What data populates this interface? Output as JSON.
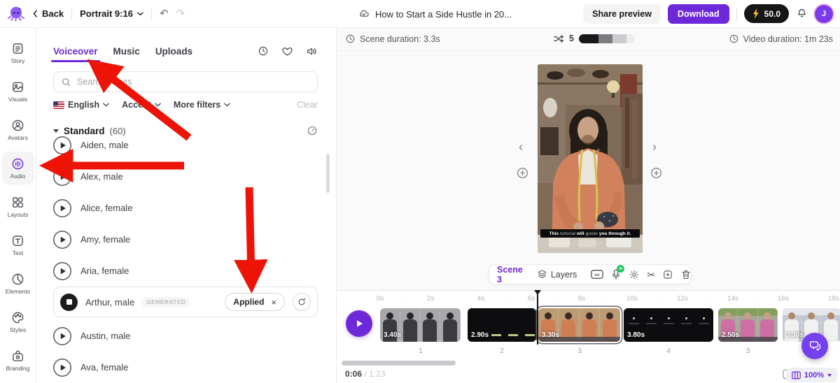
{
  "colors": {
    "accent": "#6d28d9",
    "arrow_red": "#ed1407",
    "ai_badge_green": "#22c55e",
    "credits_bg": "#161616"
  },
  "topbar": {
    "back": "Back",
    "aspect": "Portrait 9:16",
    "undo_glyph": "↶",
    "redo_glyph": "↷",
    "title": "How to Start a Side Hustle in 20...",
    "share": "Share preview",
    "download": "Download",
    "credits": "50.0",
    "avatar_initial": "J"
  },
  "sidebar": {
    "items": [
      {
        "label": "Story"
      },
      {
        "label": "Visuals"
      },
      {
        "label": "Avatars"
      },
      {
        "label": "Audio",
        "active": true
      },
      {
        "label": "Layouts"
      },
      {
        "label": "Text"
      },
      {
        "label": "Elements"
      },
      {
        "label": "Styles"
      },
      {
        "label": "Branding"
      }
    ]
  },
  "voice_panel": {
    "tabs": [
      {
        "label": "Voiceover",
        "active": true
      },
      {
        "label": "Music"
      },
      {
        "label": "Uploads"
      }
    ],
    "search_placeholder": "Search voices",
    "filters": {
      "language": "English",
      "accent": "Accent",
      "more": "More filters",
      "clear": "Clear"
    },
    "section": {
      "title": "Standard",
      "count": "(60)"
    },
    "voices": [
      {
        "name": "Aiden, male"
      },
      {
        "name": "Alex, male"
      },
      {
        "name": "Alice, female"
      },
      {
        "name": "Amy, female"
      },
      {
        "name": "Aria, female"
      },
      {
        "name": "Arthur, male",
        "badge": "GENERATED",
        "applied": "Applied",
        "remove_glyph": "×"
      },
      {
        "name": "Austin, male"
      },
      {
        "name": "Ava, female"
      }
    ]
  },
  "stage": {
    "scene_duration": "Scene duration: 3.3s",
    "scene_count": "5",
    "video_duration": "Video duration: 1m 23s",
    "nav_prev": "‹",
    "nav_next": "›",
    "caption": {
      "w1": "This",
      "w2": "tutorial",
      "w3": "will",
      "w4": "guide",
      "w5": "you through it."
    },
    "toolbar": {
      "scene": "Scene 3",
      "layers": "Layers",
      "ai_badge": "AI",
      "scissors_glyph": "✂"
    }
  },
  "timeline": {
    "ruler": [
      "0s",
      "2s",
      "4s",
      "6s",
      "8s",
      "10s",
      "12s",
      "14s",
      "16s",
      "18s"
    ],
    "tick_dot": "·",
    "clips": [
      {
        "duration": "3.40s",
        "number": "1"
      },
      {
        "duration": "2.90s",
        "number": "2"
      },
      {
        "duration": "3.30s",
        "number": "3",
        "selected": true
      },
      {
        "duration": "3.80s",
        "number": "4"
      },
      {
        "duration": "2.50s",
        "number": "5"
      },
      {
        "duration": "3.30s"
      }
    ],
    "time_current": "0:06",
    "time_rest": "/ 1:23",
    "zoom": "100%"
  }
}
